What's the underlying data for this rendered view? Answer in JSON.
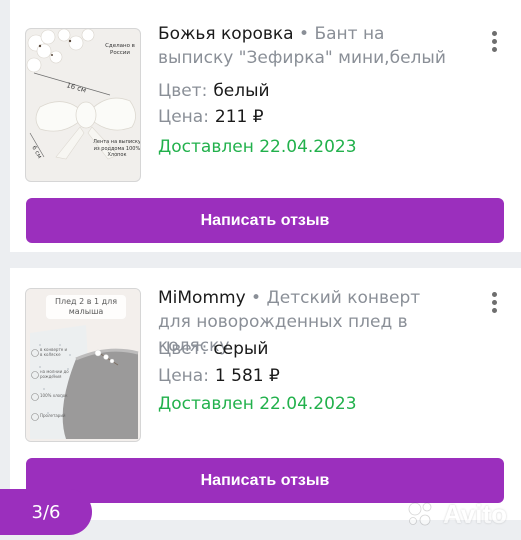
{
  "colors": {
    "accent": "#9b2fbd",
    "status_green": "#22b14c",
    "muted": "#8a8f97"
  },
  "orders": [
    {
      "seller": "Божья коровка",
      "separator": " • ",
      "product": "Бант на выписку \"Зефирка\" мини,белый",
      "color_label": "Цвет:",
      "color_value": "белый",
      "price_label": "Цена:",
      "price_value": "211 ₽",
      "status": "Доставлен 22.04.2023",
      "button_label": "Написать отзыв",
      "thumb_text": {
        "made_in": "Сделано в России",
        "width": "16 см",
        "height": "6 см",
        "material": "Лента на выписку из роддома 100% Хлопок"
      }
    },
    {
      "seller": "MiMommy",
      "separator": " • ",
      "product": "Детский конверт для новорожденных плед в коляску",
      "color_label": "Цвет:",
      "color_value": "серый",
      "price_label": "Цена:",
      "price_value": "1 581 ₽",
      "status": "Доставлен 22.04.2023",
      "button_label": "Написать отзыв",
      "thumb_text": {
        "headline": "Плед 2 в 1 для малыша",
        "feature_1": "в конверте и в коляске",
        "feature_2": "на молнии до рождения",
        "feature_3": "100% хлопок",
        "feature_4": "Пролетарий"
      }
    }
  ],
  "pager": {
    "label": "3/6"
  },
  "watermark": {
    "label": "Avito",
    "icon": "avito-logo-icon"
  }
}
